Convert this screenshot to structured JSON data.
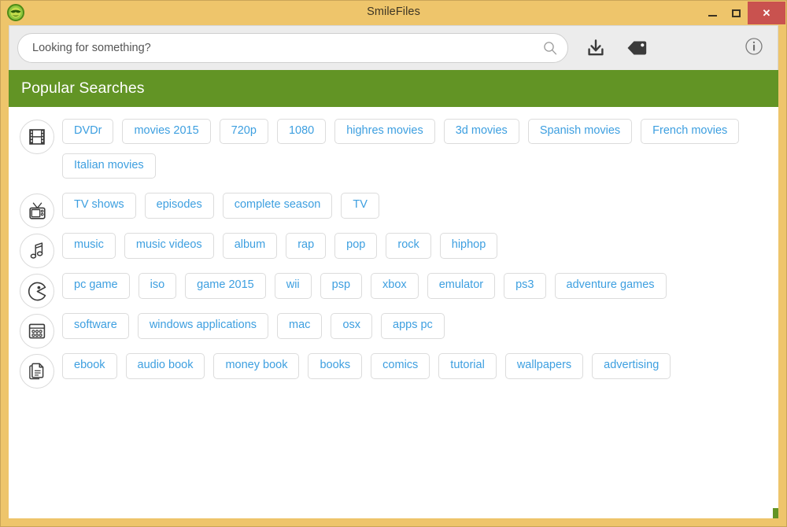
{
  "window": {
    "title": "SmileFiles",
    "app_icon": "smiley-face-icon",
    "controls": {
      "minimize": "minimize-icon",
      "maximize": "maximize-icon",
      "close": "✕"
    },
    "accent_yellow": "#eec56b",
    "accent_green": "#629425",
    "close_red": "#c9524f",
    "tag_blue": "#3d9fe0"
  },
  "toolbar": {
    "search": {
      "placeholder": "Looking for something?",
      "value": "",
      "icon": "search-icon"
    },
    "download_label": "download-icon",
    "tag_label": "tag-icon",
    "info_label": "info-icon"
  },
  "section": {
    "title": "Popular Searches"
  },
  "categories": [
    {
      "icon": "film-strip-icon",
      "name": "movies",
      "tags": [
        "DVDr",
        "movies 2015",
        "720p",
        "1080",
        "highres movies",
        "3d movies",
        "Spanish movies",
        "French movies",
        "Italian movies"
      ]
    },
    {
      "icon": "television-icon",
      "name": "tv",
      "tags": [
        "TV shows",
        "episodes",
        "complete season",
        "TV"
      ]
    },
    {
      "icon": "music-note-icon",
      "name": "music",
      "tags": [
        "music",
        "music videos",
        "album",
        "rap",
        "pop",
        "rock",
        "hiphop"
      ]
    },
    {
      "icon": "game-pacman-icon",
      "name": "games",
      "tags": [
        "pc game",
        "iso",
        "game 2015",
        "wii",
        "psp",
        "xbox",
        "emulator",
        "ps3",
        "adventure games"
      ]
    },
    {
      "icon": "application-window-icon",
      "name": "software",
      "tags": [
        "software",
        "windows applications",
        "mac",
        "osx",
        "apps pc"
      ]
    },
    {
      "icon": "document-page-icon",
      "name": "books",
      "tags": [
        "ebook",
        "audio book",
        "money book",
        "books",
        "comics",
        "tutorial",
        "wallpapers",
        "advertising"
      ]
    }
  ]
}
